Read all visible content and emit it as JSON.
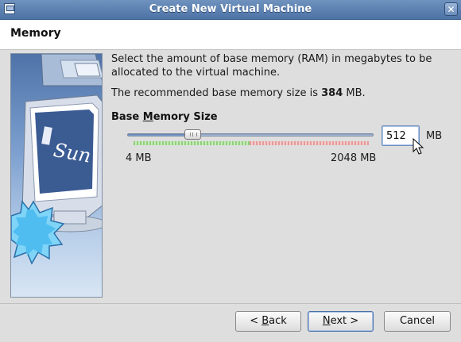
{
  "window": {
    "title": "Create New Virtual Machine",
    "close_label": "✕"
  },
  "header": {
    "heading": "Memory"
  },
  "main": {
    "description": "Select the amount of base memory (RAM) in megabytes to be allocated to the virtual machine.",
    "recommend_prefix": "The recommended base memory size is ",
    "recommend_value": "384",
    "recommend_suffix": " MB.",
    "section_title_pre": "Base ",
    "section_title_mnemonic": "M",
    "section_title_post": "emory Size",
    "slider": {
      "min_label": "4 MB",
      "max_label": "2048 MB",
      "min_mb": 4,
      "max_mb": 2048,
      "value_mb": 512,
      "recommended_fraction_green": 0.5
    },
    "input_value": "512",
    "unit_label": "MB"
  },
  "buttons": {
    "back_prefix": "< ",
    "back_mnemonic": "B",
    "back_rest": "ack",
    "next_mnemonic": "N",
    "next_rest": "ext >",
    "cancel_label": "Cancel"
  },
  "colors": {
    "titlebar": "#5a7fb3",
    "slider_ok": "#8fd07a",
    "slider_high": "#e49a9a",
    "focus": "#6f8fbf"
  },
  "icons": [
    "window-icon",
    "close-icon",
    "virtualbox-sun-logo",
    "starburst",
    "mouse-cursor-icon"
  ]
}
